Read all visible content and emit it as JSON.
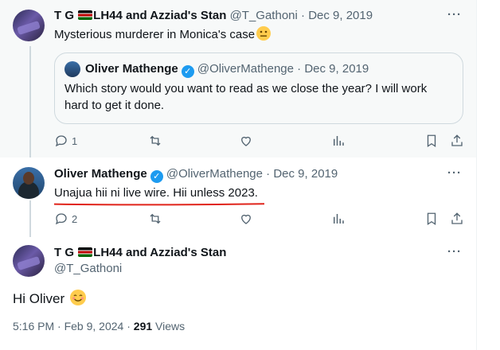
{
  "tweet1": {
    "display_name_a": "T G",
    "display_name_b": "LH44 and Azziad's Stan",
    "handle": "@T_Gathoni",
    "date": "Dec 9, 2019",
    "text": "Mysterious murderer in Monica's case",
    "quote": {
      "name": "Oliver Mathenge",
      "handle": "@OliverMathenge",
      "date": "Dec 9, 2019",
      "line1": "Which story would you want to read as we close the year? I will work",
      "line2": "hard to get it done."
    },
    "reply_count": "1",
    "more": "···"
  },
  "tweet2": {
    "name": "Oliver Mathenge",
    "handle": "@OliverMathenge",
    "date": "Dec 9, 2019",
    "text": "Unajua hii ni live wire. Hii unless 2023.",
    "reply_count": "2",
    "more": "···",
    "underline_color": "#e0241b"
  },
  "tweet3": {
    "display_name_a": "T G",
    "display_name_b": "LH44 and Azziad's Stan",
    "handle": "@T_Gathoni",
    "text": "Hi Oliver",
    "time": "5:16 PM",
    "date": "Feb 9, 2024",
    "views_count": "291",
    "views_label": "Views",
    "more": "···"
  },
  "separators": {
    "dot": "·"
  },
  "colors": {
    "verified": "#1d9bf0",
    "muted": "#536471",
    "thread_line": "#cfd9de"
  }
}
